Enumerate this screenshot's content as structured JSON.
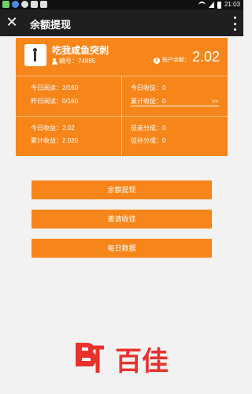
{
  "status_bar": {
    "time": "21:03"
  },
  "titlebar": {
    "close_icon": "close-icon",
    "title": "余额提现",
    "more_icon": "more-vertical-icon"
  },
  "profile": {
    "nickname": "吃我咸鱼突刺",
    "id_label": "编号：74885",
    "balance_label": "账户余额：",
    "balance_value": "2.02",
    "colors": {
      "card": "#f6861a",
      "button": "#f6861a"
    }
  },
  "stats": {
    "today_reads": "今日阅读：2/160",
    "yesterday_reads": "昨日阅读：0/160",
    "today_apprentices": "今日收徒：0",
    "total_apprentices": "累计收徒：0",
    "more_arrow": ">>",
    "today_income": "今日收益：2.02",
    "total_income": "累计收益：2.020",
    "disciple_share": "徒弟分成：0",
    "grand_disciple_share": "徒孙分成：0"
  },
  "buttons": {
    "withdraw": "余额提现",
    "invite": "邀请收徒",
    "daily": "每日数据"
  },
  "watermark": {
    "text": "百佳"
  }
}
